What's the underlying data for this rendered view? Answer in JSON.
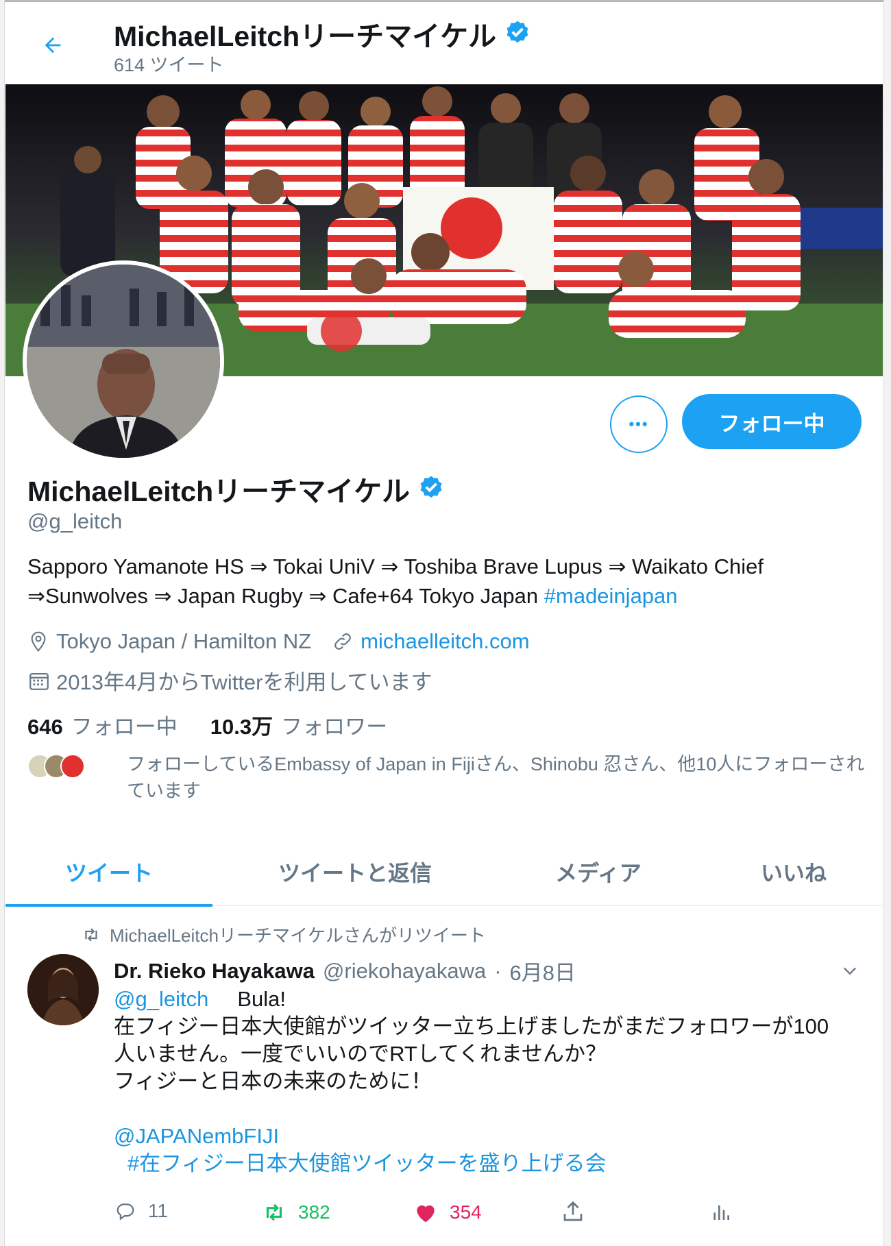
{
  "header": {
    "title": "MichaelLeitchリーチマイケル",
    "tweet_count": "614 ツイート"
  },
  "profile": {
    "name": "MichaelLeitchリーチマイケル",
    "handle": "@g_leitch",
    "bio_text": "Sapporo Yamanote HS ⇒ Tokai UniV ⇒ Toshiba Brave Lupus ⇒ Waikato Chief ⇒Sunwolves ⇒ Japan Rugby ⇒ Cafe+64 Tokyo Japan ",
    "bio_hashtag": "#madeinjapan",
    "location": "Tokyo Japan / Hamilton NZ",
    "website": "michaelleitch.com",
    "joined": "2013年4月からTwitterを利用しています",
    "following_count": "646",
    "following_label": "フォロー中",
    "followers_count": "10.3万",
    "followers_label": "フォロワー",
    "followed_by_text": "フォローしているEmbassy of Japan in Fijiさん、Shinobu 忍さん、他10人にフォローされています"
  },
  "buttons": {
    "more_label": "•••",
    "follow_label": "フォロー中"
  },
  "tabs": [
    {
      "label": "ツイート",
      "active": true
    },
    {
      "label": "ツイートと返信",
      "active": false
    },
    {
      "label": "メディア",
      "active": false
    },
    {
      "label": "いいね",
      "active": false
    }
  ],
  "tweet": {
    "retweet_context": "MichaelLeitchリーチマイケルさんがリツイート",
    "author_name": "Dr. Rieko Hayakawa",
    "author_handle": "@riekohayakawa",
    "separator": "·",
    "date": "6月8日",
    "mention": "@g_leitch",
    "greeting": "Bula!",
    "line1": "在フィジー日本大使館がツイッター立ち上げましたがまだフォロワーが100",
    "line2": "人いません。一度でいいのでRTしてくれませんか？",
    "line3": "フィジーと日本の未来のために！",
    "mention2": "@JAPANembFIJI",
    "hashtag": "#在フィジー日本大使館ツイッターを盛り上げる会",
    "reply_count": "11",
    "retweet_count": "382",
    "like_count": "354"
  },
  "colors": {
    "accent": "#1da1f2",
    "link": "#1b95e0",
    "secondary_text": "#657786",
    "retweet_green": "#17bf63",
    "like_red": "#e0245e"
  },
  "icons": [
    "back-arrow-icon",
    "verified-badge-icon",
    "location-icon",
    "link-icon",
    "calendar-icon",
    "retweet-icon",
    "chevron-down-icon",
    "reply-icon",
    "like-icon",
    "share-icon",
    "analytics-icon"
  ]
}
